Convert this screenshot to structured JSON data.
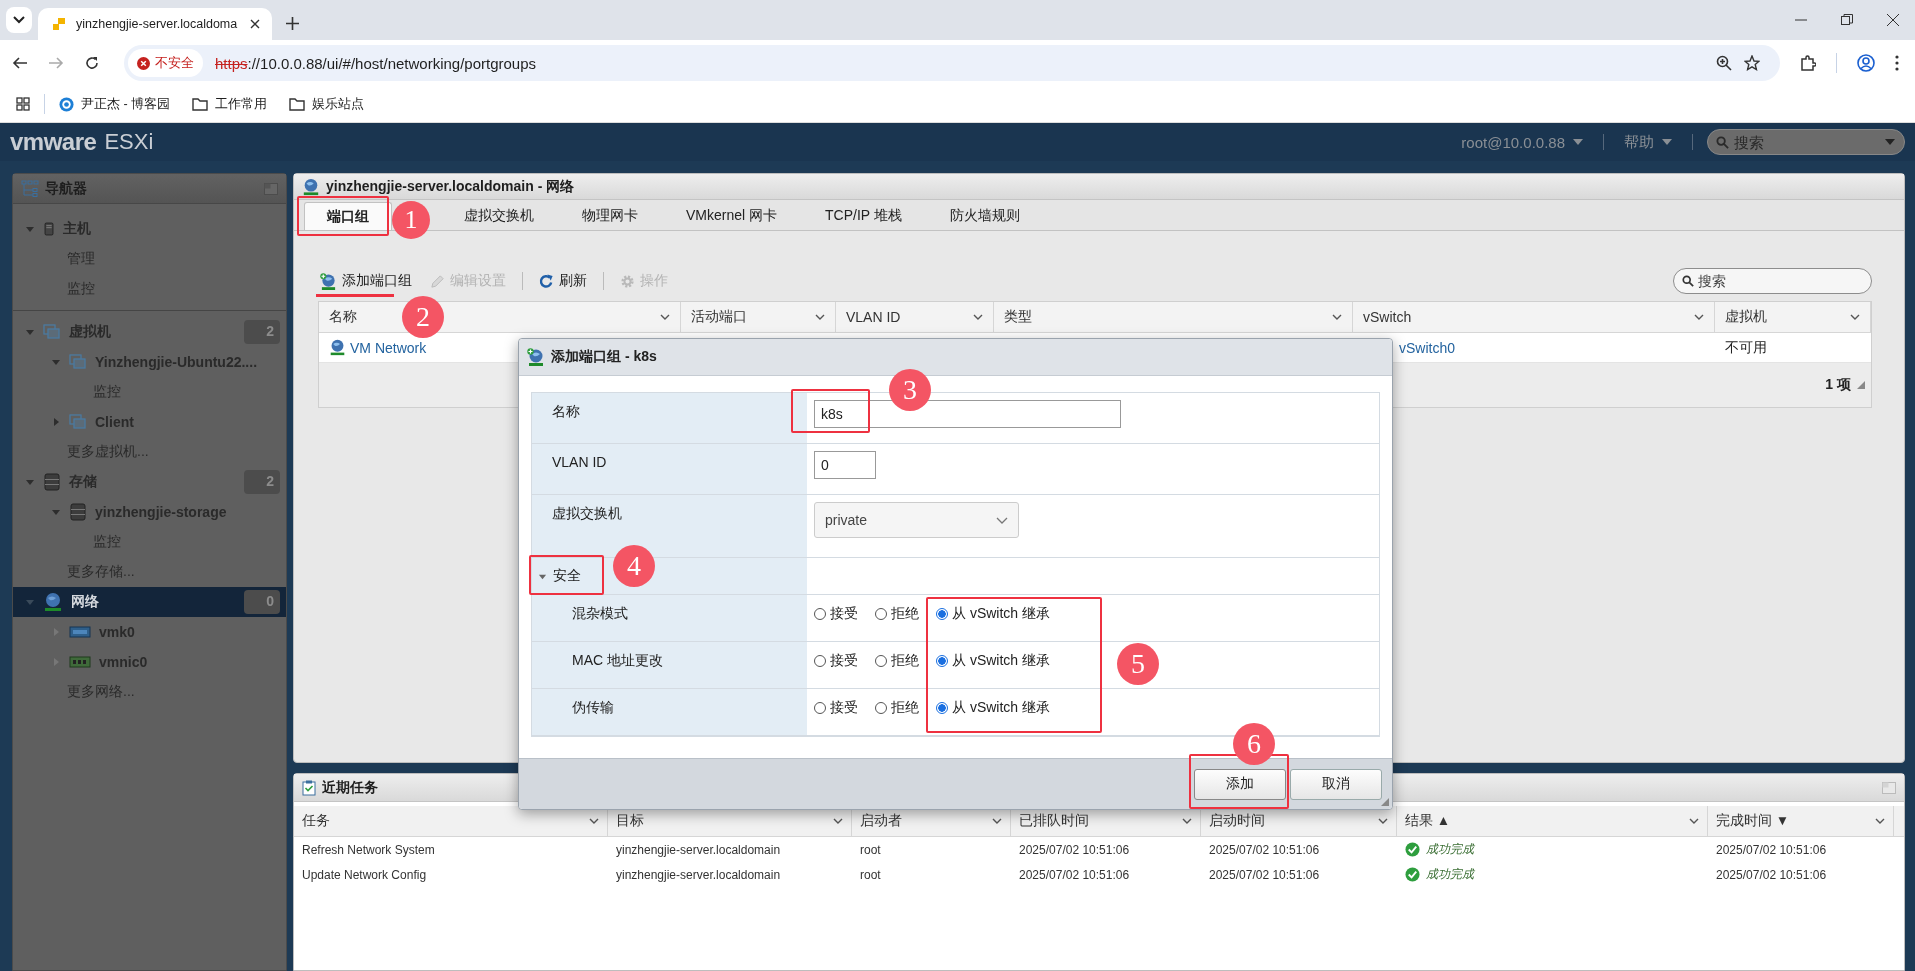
{
  "browser": {
    "tab": {
      "title": "yinzhengjie-server.localdoma",
      "selected": true
    },
    "security_chip": "不安全",
    "url": {
      "scheme": "https",
      "rest": "://10.0.0.88/ui/#/host/networking/portgroups"
    },
    "bookmarks": [
      {
        "kind": "site",
        "label": "尹正杰 - 博客园"
      },
      {
        "kind": "folder",
        "label": "工作常用"
      },
      {
        "kind": "folder",
        "label": "娱乐站点"
      }
    ]
  },
  "header": {
    "logo": "vmware",
    "product": "ESXi",
    "user_menu": "root@10.0.0.88",
    "help_menu": "帮助",
    "search": {
      "placeholder": "搜索"
    }
  },
  "navigator": {
    "title": "导航器",
    "items": [
      {
        "kind": "host",
        "label": "主机",
        "expanded": true,
        "selected": false,
        "children": [
          {
            "kind": "link",
            "label": "管理",
            "selected": false
          },
          {
            "kind": "link",
            "label": "监控",
            "selected": false
          }
        ]
      },
      {
        "kind": "vm",
        "label": "虚拟机",
        "expanded": true,
        "selected": false,
        "badge": "2",
        "children": [
          {
            "kind": "vm",
            "label": "Yinzhengjie-Ubuntu22....",
            "expanded": true,
            "selected": false,
            "children": [
              {
                "kind": "link",
                "label": "监控",
                "selected": false
              }
            ]
          },
          {
            "kind": "vm",
            "label": "Client",
            "expanded": false,
            "selected": false
          },
          {
            "kind": "link",
            "label": "更多虚拟机...",
            "selected": false
          }
        ]
      },
      {
        "kind": "storage",
        "label": "存储",
        "expanded": true,
        "selected": false,
        "badge": "2",
        "children": [
          {
            "kind": "storage",
            "label": "yinzhengjie-storage",
            "expanded": true,
            "selected": false,
            "children": [
              {
                "kind": "link",
                "label": "监控",
                "selected": false
              }
            ]
          },
          {
            "kind": "link",
            "label": "更多存储...",
            "selected": false
          }
        ]
      },
      {
        "kind": "network",
        "label": "网络",
        "expanded": true,
        "selected": true,
        "badge": "0",
        "children": [
          {
            "kind": "vmkernel-nic",
            "label": "vmk0",
            "expanded": false,
            "selected": false
          },
          {
            "kind": "physical-nic",
            "label": "vmnic0",
            "expanded": false,
            "selected": false
          },
          {
            "kind": "link",
            "label": "更多网络...",
            "selected": false
          }
        ]
      }
    ]
  },
  "main": {
    "title": "yinzhengjie-server.localdomain - 网络",
    "tabs": [
      {
        "label": "端口组",
        "selected": true,
        "callout": {
          "number": "1",
          "kind": "box"
        }
      },
      {
        "label": "虚拟交换机",
        "selected": false
      },
      {
        "label": "物理网卡",
        "selected": false
      },
      {
        "label": "VMkernel 网卡",
        "selected": false
      },
      {
        "label": "TCP/IP 堆栈",
        "selected": false
      },
      {
        "label": "防火墙规则",
        "selected": false
      }
    ],
    "toolbar": [
      {
        "kind": "add",
        "label": "添加端口组",
        "disabled": false,
        "callout": {
          "number": "2",
          "kind": "underline"
        }
      },
      {
        "kind": "edit",
        "label": "编辑设置",
        "disabled": true
      },
      {
        "kind": "refresh",
        "label": "刷新",
        "disabled": false
      },
      {
        "kind": "actions",
        "label": "操作",
        "disabled": true
      }
    ],
    "search": {
      "placeholder": "搜索"
    },
    "table": {
      "columns": [
        "名称",
        "活动端口",
        "VLAN ID",
        "类型",
        "vSwitch",
        "虚拟机"
      ],
      "rows": [
        {
          "name": "VM Network",
          "vswitch": "vSwitch0",
          "vm": "不可用"
        }
      ],
      "footer": "1 项"
    }
  },
  "dialog": {
    "title": "添加端口组 - k8s",
    "name": {
      "label": "名称",
      "value": "k8s",
      "callout": {
        "number": "3",
        "kind": "box"
      }
    },
    "vlan": {
      "label": "VLAN ID",
      "value": "0"
    },
    "vswitch": {
      "label": "虚拟交换机",
      "value": "private"
    },
    "security": {
      "label": "安全",
      "expanded": true,
      "callout": {
        "number": "4",
        "kind": "box"
      },
      "inherit_callout": {
        "number": "5",
        "kind": "box"
      },
      "rows": [
        {
          "label": "混杂模式",
          "options": [
            {
              "label": "接受",
              "selected": false
            },
            {
              "label": "拒绝",
              "selected": false
            },
            {
              "label": "从 vSwitch 继承",
              "selected": true
            }
          ]
        },
        {
          "label": "MAC 地址更改",
          "options": [
            {
              "label": "接受",
              "selected": false
            },
            {
              "label": "拒绝",
              "selected": false
            },
            {
              "label": "从 vSwitch 继承",
              "selected": true
            }
          ]
        },
        {
          "label": "伪传输",
          "options": [
            {
              "label": "接受",
              "selected": false
            },
            {
              "label": "拒绝",
              "selected": false
            },
            {
              "label": "从 vSwitch 继承",
              "selected": true
            }
          ]
        }
      ]
    },
    "buttons": [
      {
        "kind": "primary",
        "label": "添加",
        "callout": {
          "number": "6",
          "kind": "box"
        }
      },
      {
        "kind": "secondary",
        "label": "取消"
      }
    ]
  },
  "recent_tasks": {
    "title": "近期任务",
    "columns": [
      "任务",
      "目标",
      "启动者",
      "已排队时间",
      "启动时间",
      "结果 ▲",
      "完成时间 ▼"
    ],
    "rows": [
      {
        "task": "Refresh Network System",
        "target": "yinzhengjie-server.localdomain",
        "initiator": "root",
        "queued": "2025/07/02 10:51:06",
        "started": "2025/07/02 10:51:06",
        "result": "成功完成",
        "completed": "2025/07/02 10:51:06"
      },
      {
        "task": "Update Network Config",
        "target": "yinzhengjie-server.localdomain",
        "initiator": "root",
        "queued": "2025/07/02 10:51:06",
        "started": "2025/07/02 10:51:06",
        "result": "成功完成",
        "completed": "2025/07/02 10:51:06"
      }
    ]
  }
}
